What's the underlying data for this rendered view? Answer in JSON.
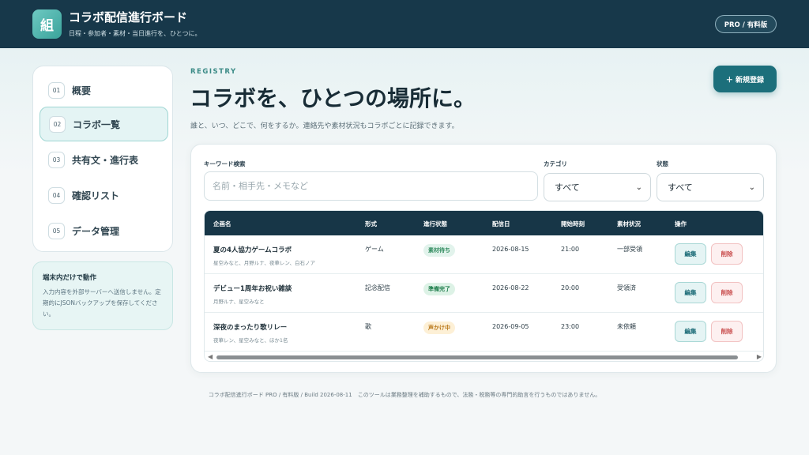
{
  "header": {
    "logo_char": "組",
    "title": "コラボ配信進行ボード",
    "subtitle": "日程・参加者・素材・当日進行を、ひとつに。",
    "plan_badge": "PRO / 有料版"
  },
  "sidebar": {
    "items": [
      {
        "num": "01",
        "label": "概要"
      },
      {
        "num": "02",
        "label": "コラボ一覧"
      },
      {
        "num": "03",
        "label": "共有文・進行表"
      },
      {
        "num": "04",
        "label": "確認リスト"
      },
      {
        "num": "05",
        "label": "データ管理"
      }
    ],
    "notice_title": "端末内だけで動作",
    "notice_body": "入力内容を外部サーバーへ送信しません。定期的にJSONバックアップを保存してください。"
  },
  "main": {
    "eyebrow": "REGISTRY",
    "title": "コラボを、ひとつの場所に。",
    "description": "誰と、いつ、どこで、何をするか。連絡先や素材状況もコラボごとに記録できます。",
    "new_button": "＋ 新規登録"
  },
  "filters": {
    "keyword_label": "キーワード検索",
    "keyword_placeholder": "名前・相手先・メモなど",
    "keyword_value": "",
    "category_label": "カテゴリ",
    "category_value": "すべて",
    "status_label": "状態",
    "status_value": "すべて"
  },
  "table": {
    "headers": [
      "企画名",
      "形式",
      "進行状態",
      "配信日",
      "開始時刻",
      "素材状況",
      "操作"
    ],
    "rows": [
      {
        "title": "夏の4人協力ゲームコラボ",
        "members": "星空みなと、月野ルナ、夜華レン、白石ノア",
        "format": "ゲーム",
        "status": "素材待ち",
        "date": "2026-08-15",
        "time": "21:00",
        "material": "一部受領",
        "status_color": "#e2f3ec",
        "status_text_color": "#2f8a5d"
      },
      {
        "title": "デビュー1周年お祝い雑談",
        "members": "月野ルナ、星空みなと",
        "format": "記念配信",
        "status": "準備完了",
        "date": "2026-08-22",
        "time": "20:00",
        "material": "受領済",
        "status_color": "#ddf2e6",
        "status_text_color": "#23804f"
      },
      {
        "title": "深夜のまったり歌リレー",
        "members": "夜華レン、星空みなと、ほか1名",
        "format": "歌",
        "status": "声かけ中",
        "date": "2026-09-05",
        "time": "23:00",
        "material": "未依頼",
        "status_color": "#fdf0d6",
        "status_text_color": "#b9781a"
      }
    ],
    "edit_label": "編集",
    "delete_label": "削除"
  },
  "footer": {
    "text": "コラボ配信進行ボード PRO / 有料版 / Build 2026-08-11　このツールは業務整理を補助するもので、法務・税務等の専門的助言を行うものではありません。"
  },
  "colors": {
    "header_bg": "#17384a",
    "accent": "#1c6f7b",
    "table_header_bg": "#173647"
  }
}
